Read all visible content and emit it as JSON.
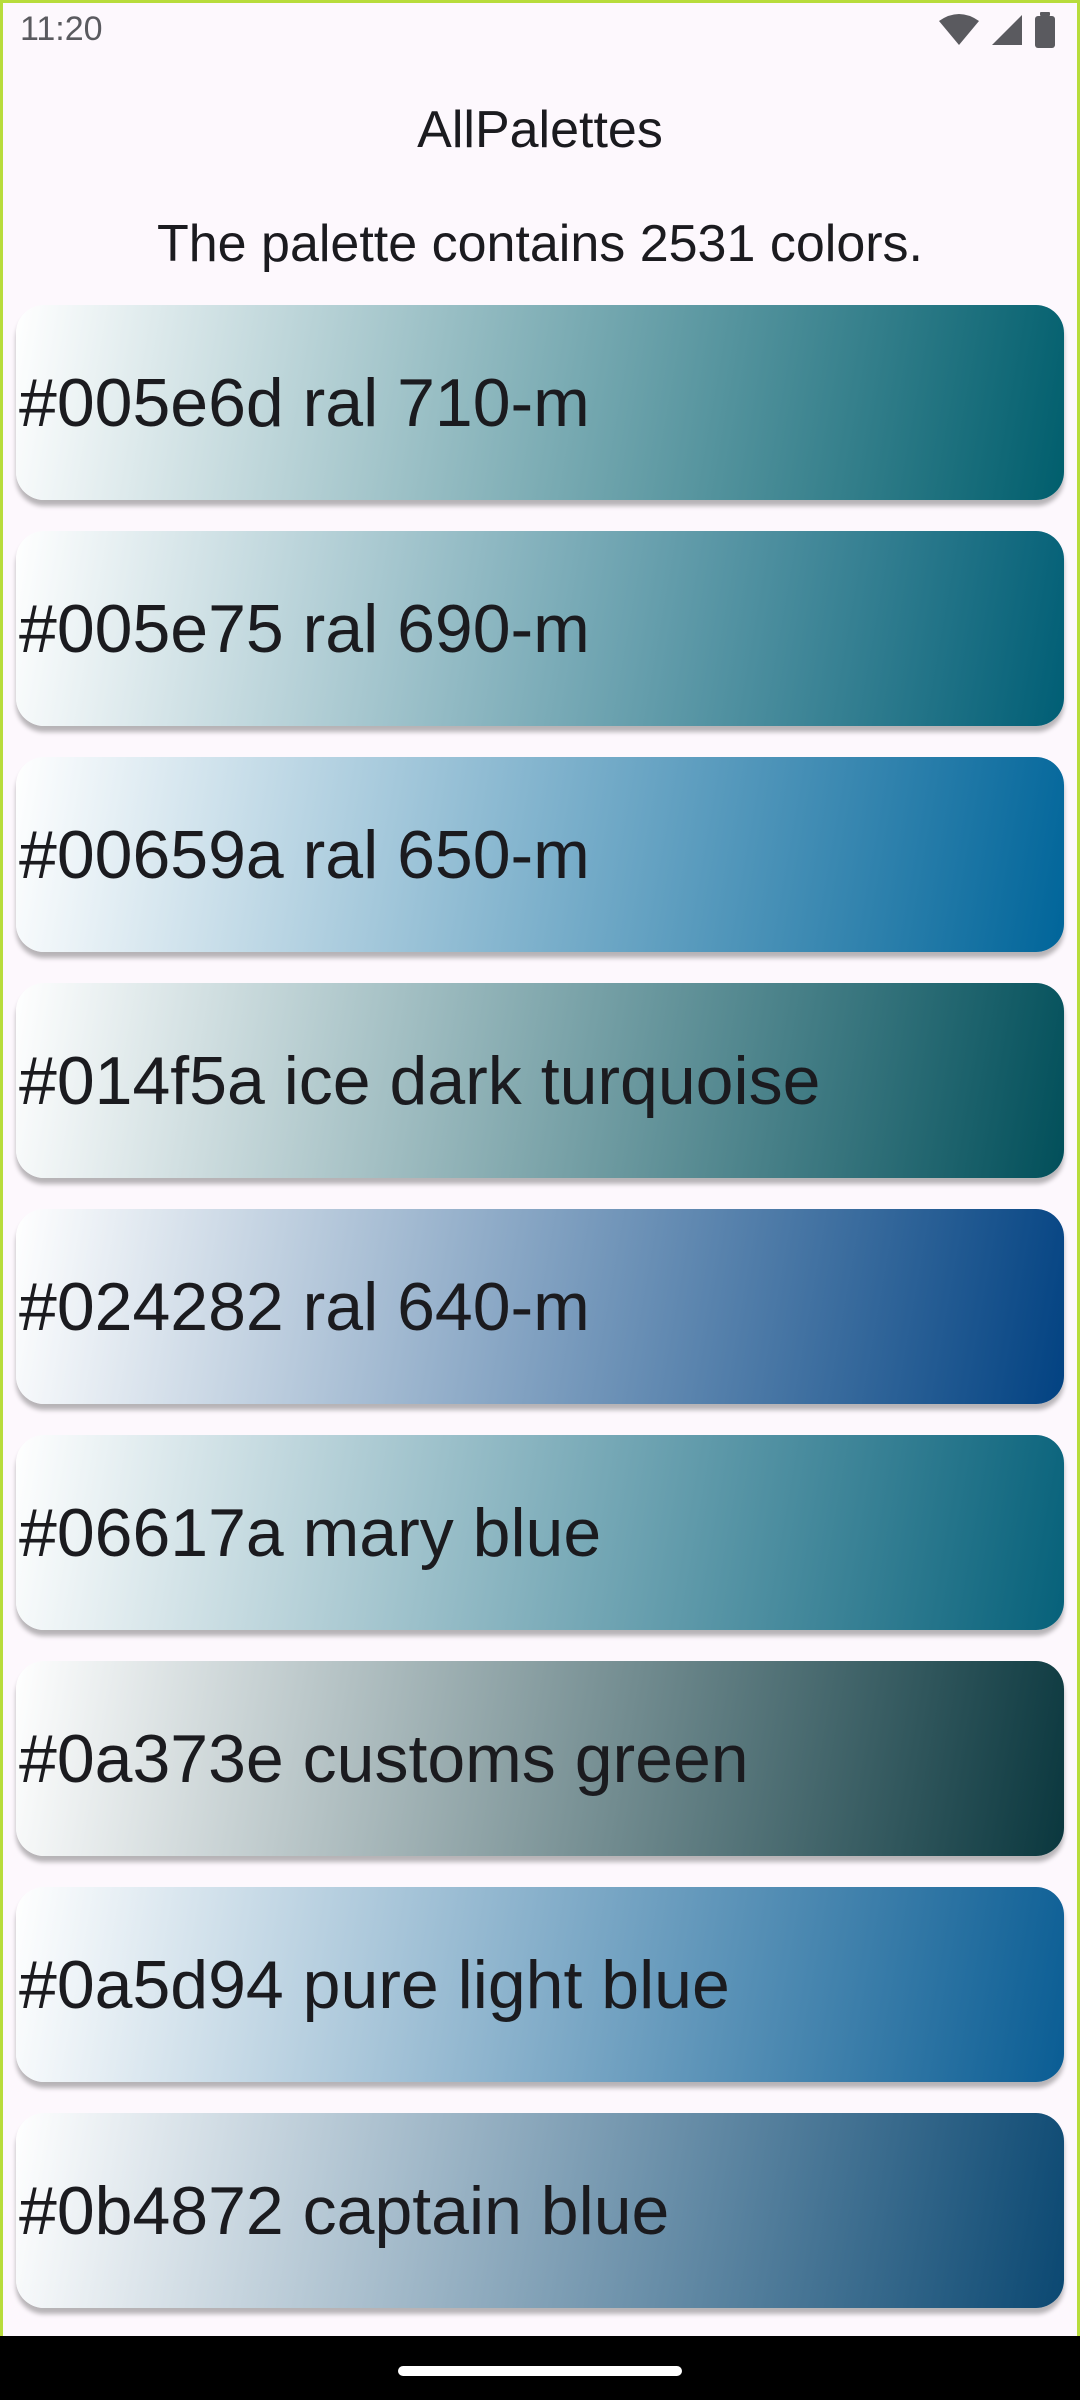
{
  "status_bar": {
    "time": "11:20",
    "icons": [
      "wifi-icon",
      "cell-signal-icon",
      "battery-icon"
    ]
  },
  "header": {
    "title": "AllPalettes",
    "subtitle": "The palette contains 2531 colors."
  },
  "colors": [
    {
      "label": "#005e6d ral 710-m",
      "hex": "#005e6d"
    },
    {
      "label": "#005e75 ral 690-m",
      "hex": "#005e75"
    },
    {
      "label": "#00659a ral 650-m",
      "hex": "#00659a"
    },
    {
      "label": "#014f5a ice dark turquoise",
      "hex": "#014f5a"
    },
    {
      "label": "#024282 ral 640-m",
      "hex": "#024282"
    },
    {
      "label": "#06617a mary blue",
      "hex": "#06617a"
    },
    {
      "label": "#0a373e customs green",
      "hex": "#0a373e"
    },
    {
      "label": "#0a5d94 pure light blue",
      "hex": "#0a5d94"
    },
    {
      "label": "#0b4872 captain blue",
      "hex": "#0b4872"
    }
  ],
  "theme": {
    "background": "#fdf8fd",
    "card_start": "#ffffff",
    "frame_accent": "#b8dc3c"
  }
}
